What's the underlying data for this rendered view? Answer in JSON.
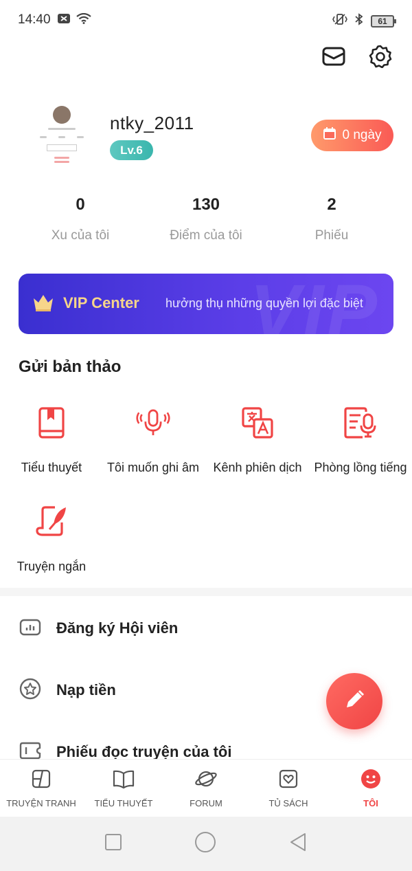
{
  "status_bar": {
    "time": "14:40",
    "battery": "61"
  },
  "profile": {
    "username": "ntky_2011",
    "level": "Lv.6",
    "checkin_label": "0 ngày"
  },
  "stats": [
    {
      "value": "0",
      "label": "Xu của tôi"
    },
    {
      "value": "130",
      "label": "Điểm của tôi"
    },
    {
      "value": "2",
      "label": "Phiếu"
    }
  ],
  "vip": {
    "title": "VIP Center",
    "description": "hưởng thụ những quyền lợi đặc biệt",
    "watermark": "VIP"
  },
  "submit_section": {
    "title": "Gửi bản thảo",
    "tools": [
      {
        "label": "Tiểu thuyết",
        "icon": "book-icon"
      },
      {
        "label": "Tôi muốn ghi âm",
        "icon": "microphone-icon"
      },
      {
        "label": "Kênh phiên dịch",
        "icon": "translate-icon"
      },
      {
        "label": "Phòng lồng tiếng",
        "icon": "dubbing-icon"
      },
      {
        "label": "Truyện ngắn",
        "icon": "scroll-quill-icon"
      }
    ]
  },
  "menu": [
    {
      "label": "Đăng ký Hội viên",
      "icon": "membership-card-icon"
    },
    {
      "label": "Nạp tiền",
      "icon": "star-circle-icon"
    },
    {
      "label": "Phiếu đọc truyện của tôi",
      "icon": "ticket-icon"
    }
  ],
  "bottom_nav": [
    {
      "label": "TRUYỆN TRANH",
      "icon": "comic-icon",
      "active": false
    },
    {
      "label": "TIỂU THUYẾT",
      "icon": "open-book-icon",
      "active": false
    },
    {
      "label": "FORUM",
      "icon": "planet-icon",
      "active": false
    },
    {
      "label": "TỦ SÁCH",
      "icon": "bookshelf-heart-icon",
      "active": false
    },
    {
      "label": "TÔI",
      "icon": "smiley-icon",
      "active": true
    }
  ],
  "colors": {
    "accent": "#f04545",
    "vip_gradient_start": "#3a2fd0",
    "vip_gradient_end": "#6c46f0",
    "level_badge": "#3ab6ad"
  }
}
